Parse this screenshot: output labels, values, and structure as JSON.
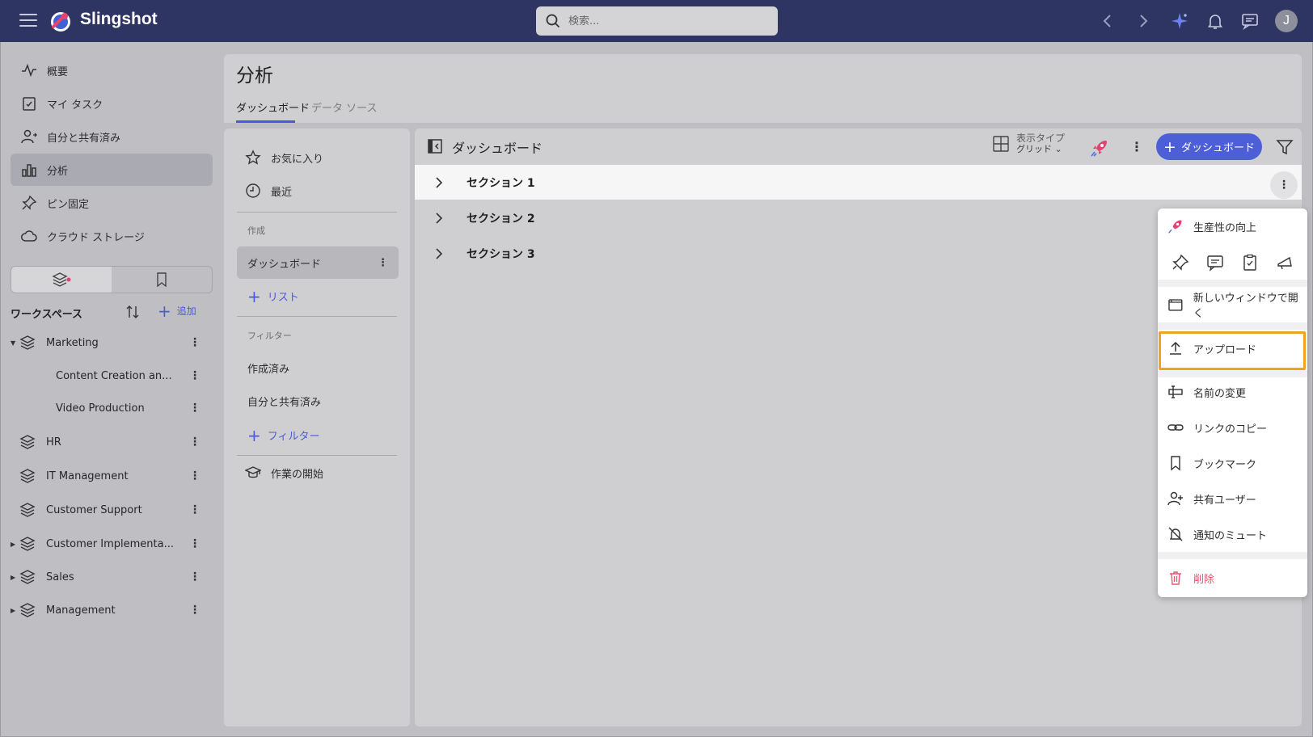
{
  "app": {
    "brand": "Slingshot"
  },
  "search": {
    "placeholder": "検索..."
  },
  "topbar": {
    "avatar_initial": "J"
  },
  "nav": {
    "items": [
      {
        "label": "概要",
        "icon": "activity-icon"
      },
      {
        "label": "マイ タスク",
        "icon": "task-icon"
      },
      {
        "label": "自分と共有済み",
        "icon": "shared-user-icon"
      },
      {
        "label": "分析",
        "icon": "bar-chart-icon",
        "active": true
      },
      {
        "label": "ピン固定",
        "icon": "pin-icon"
      },
      {
        "label": "クラウド ストレージ",
        "icon": "cloud-icon"
      }
    ]
  },
  "workspace": {
    "title": "ワークスペース",
    "add_label": "追加",
    "items": [
      {
        "label": "Marketing",
        "expanded": true
      },
      {
        "label": "Content Creation an...",
        "child": true
      },
      {
        "label": "Video Production",
        "child": true
      },
      {
        "label": "HR"
      },
      {
        "label": "IT Management"
      },
      {
        "label": "Customer Support"
      },
      {
        "label": "Customer Implementa..."
      },
      {
        "label": "Sales"
      },
      {
        "label": "Management"
      }
    ]
  },
  "page": {
    "title": "分析",
    "tabs": [
      {
        "label": "ダッシュボード",
        "active": true
      },
      {
        "label": "データ ソース"
      }
    ]
  },
  "subnav": {
    "favorites": "お気に入り",
    "recent": "最近",
    "create_head": "作成",
    "dashboard": "ダッシュボード",
    "add_list": "リスト",
    "filter_head": "フィルター",
    "created": "作成済み",
    "shared": "自分と共有済み",
    "add_filter": "フィルター",
    "get_started": "作業の開始"
  },
  "dashboard": {
    "title": "ダッシュボード",
    "view_type_label": "表示タイプ",
    "view_type_value": "グリッド",
    "add_button": "ダッシュボード",
    "sections": [
      "セクション 1",
      "セクション 2",
      "セクション 3"
    ]
  },
  "menu": {
    "productivity": "生産性の向上",
    "open_new_window": "新しいウィンドウで開く",
    "upload": "アップロード",
    "rename": "名前の変更",
    "copy_link": "リンクのコピー",
    "bookmark": "ブックマーク",
    "share_users": "共有ユーザー",
    "mute": "通知のミュート",
    "delete": "削除"
  },
  "colors": {
    "topbar": "#2f3563",
    "accent": "#4a5bd8",
    "highlight": "#f0a31e",
    "danger": "#e8566b"
  }
}
